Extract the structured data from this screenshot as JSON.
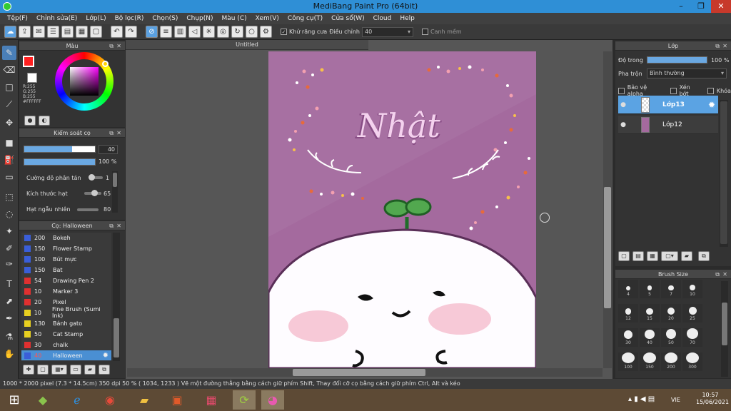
{
  "window": {
    "title": "MediBang Paint Pro (64bit)",
    "min": "–",
    "max": "❐",
    "close": "✕"
  },
  "menu": [
    "Tệp(F)",
    "Chỉnh sửa(E)",
    "Lớp(L)",
    "Bộ lọc(R)",
    "Chọn(S)",
    "Chụp(N)",
    "Màu (C)",
    "Xem(V)",
    "Công cụ(T)",
    "Cửa sổ(W)",
    "Cloud",
    "Help"
  ],
  "toolbar": {
    "antialias_label": "Khử răng cưa",
    "adjust_label": "Điều chỉnh",
    "adjust_value": "40",
    "ruler_label": "Canh mềm"
  },
  "color_panel": {
    "title": "Màu",
    "r": "R:255",
    "g": "G:255",
    "b": "B:255",
    "hex": "#FFFFFF",
    "primary_color": "#ff2020",
    "secondary_color": "#ffffff"
  },
  "brush_control": {
    "title": "Kiểm soát cọ",
    "size_value": "40",
    "size_fraction": 0.68,
    "opacity_value": "100 %",
    "opacity_fraction": 1.0,
    "scatter_label": "Cường độ phân tán",
    "scatter_value": "1",
    "grain_label": "Kích thước hạt",
    "grain_value": "65",
    "random_label": "Hạt ngẫu nhiên",
    "random_value": "80"
  },
  "brush_list": {
    "title": "Cọ: Halloween",
    "items": [
      {
        "size": "200",
        "name": "Bokeh",
        "color": "#3a5ed8"
      },
      {
        "size": "150",
        "name": "Flower Stamp",
        "color": "#3a5ed8"
      },
      {
        "size": "100",
        "name": "Bút mực",
        "color": "#3a5ed8"
      },
      {
        "size": "150",
        "name": "Bat",
        "color": "#3a5ed8"
      },
      {
        "size": "54",
        "name": "Drawing Pen 2",
        "color": "#e03030"
      },
      {
        "size": "10",
        "name": "Marker 3",
        "color": "#e03030"
      },
      {
        "size": "20",
        "name": "Pixel",
        "color": "#e03030"
      },
      {
        "size": "10",
        "name": "Fine Brush (Sumi Ink)",
        "color": "#e8d020"
      },
      {
        "size": "130",
        "name": "Bánh gato",
        "color": "#e8d020"
      },
      {
        "size": "50",
        "name": "Cat Stamp",
        "color": "#e8d020"
      },
      {
        "size": "30",
        "name": "chalk",
        "color": "#e03030"
      },
      {
        "size": "40",
        "name": "Halloween",
        "color": "#3a5ed8",
        "selected": true
      }
    ]
  },
  "document": {
    "tab_title": "Untitled",
    "canvas_color": "#a46a9e",
    "art_text": "Nhật"
  },
  "layer_panel": {
    "title": "Lớp",
    "opacity_label": "Độ trong",
    "opacity_value": "100 %",
    "opacity_fraction": 1.0,
    "blend_label": "Pha trộn",
    "blend_value": "Bình thường",
    "protect_alpha": "Bảo vệ alpha",
    "clip": "Xén bớt",
    "lock": "Khóa",
    "layers": [
      {
        "name": "Lớp13",
        "selected": true
      },
      {
        "name": "Lớp12",
        "selected": false
      }
    ]
  },
  "brush_size": {
    "title": "Brush Size",
    "sizes": [
      "4",
      "5",
      "7",
      "10",
      "12",
      "15",
      "20",
      "25",
      "30",
      "40",
      "50",
      "70",
      "100",
      "150",
      "200",
      "300"
    ]
  },
  "status": {
    "text": "1000 * 2000 pixel   (7.3 * 14.5cm)   350 dpi   50 %   ( 1034, 1233 )   Vẽ một đường thẳng bằng cách giữ phím Shift, Thay đổi cỡ cọ bằng cách giữ phím Ctrl, Alt và kéo"
  },
  "taskbar": {
    "lang": "VIE",
    "time": "10:57",
    "date": "15/06/2021"
  }
}
